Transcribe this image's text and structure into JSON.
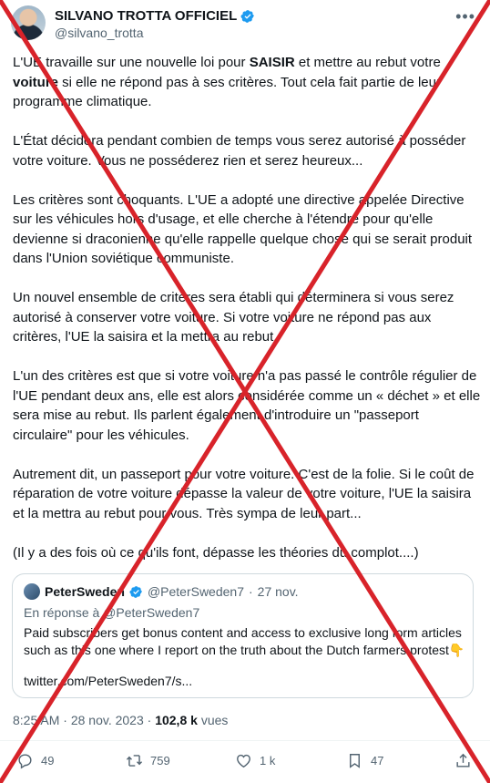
{
  "author": {
    "name": "SILVANO TROTTA OFFICIEL",
    "handle": "@silvano_trotta"
  },
  "tweet": {
    "paragraphs": [
      {
        "parts": [
          {
            "text": "L'UE travaille sur une nouvelle loi pour ",
            "bold": false
          },
          {
            "text": "SAISIR",
            "bold": true
          },
          {
            "text": " et mettre au rebut votre ",
            "bold": false
          },
          {
            "text": "voiture",
            "bold": true
          },
          {
            "text": " si elle ne répond pas à ses critères.  Tout cela fait partie de leur programme climatique.",
            "bold": false
          }
        ]
      },
      {
        "parts": [
          {
            "text": "L'État décidera pendant combien de temps vous serez autorisé à posséder votre voiture.  Vous ne posséderez rien et serez heureux...",
            "bold": false
          }
        ]
      },
      {
        "parts": [
          {
            "text": "Les critères sont choquants.  L'UE a adopté une directive appelée Directive sur les véhicules hors d'usage, et elle cherche à l'étendre pour qu'elle devienne si draconienne qu'elle rappelle quelque chose qui se serait produit dans l'Union soviétique communiste.",
            "bold": false
          }
        ]
      },
      {
        "parts": [
          {
            "text": "Un nouvel ensemble de critères sera établi qui déterminera si vous serez autorisé à conserver votre voiture. Si votre voiture ne répond pas aux critères, l'UE la saisira et la mettra au rebut.",
            "bold": false
          }
        ]
      },
      {
        "parts": [
          {
            "text": "L'un des critères est que si votre voiture n'a pas passé le contrôle régulier de l'UE pendant deux ans, elle est alors considérée comme un « déchet » et elle sera mise au rebut.  Ils parlent également d'introduire un \"passeport circulaire\" pour les véhicules.",
            "bold": false
          }
        ]
      },
      {
        "parts": [
          {
            "text": "Autrement dit, un passeport pour votre voiture. C'est de la folie.  Si le coût de réparation de votre voiture dépasse la valeur de votre voiture, l'UE la saisira et la mettra au rebut pour vous. Très sympa de leur part...",
            "bold": false
          }
        ]
      },
      {
        "parts": [
          {
            "text": "(Il y a des fois où ce qu'ils font, dépasse les théories du complot....)",
            "bold": false
          }
        ]
      }
    ]
  },
  "quote": {
    "name": "PeterSweden",
    "handle": "@PeterSweden7",
    "separator": "·",
    "date": "27 nov.",
    "reply_to": "En réponse à @PeterSweden7",
    "body": "Paid subscribers get bonus content and access to exclusive long form articles such as this one where I report on the truth about the Dutch farmers protest",
    "emoji": "👇",
    "link": "twitter.com/PeterSweden7/s..."
  },
  "meta": {
    "time": "8:25 AM",
    "separator": "·",
    "date": "28 nov. 2023",
    "views_count": "102,8 k",
    "views_label": "vues"
  },
  "actions": {
    "replies": "49",
    "retweets": "759",
    "likes": "1 k",
    "bookmarks": "47"
  },
  "icons": {
    "verified": "verified-badge-icon",
    "more": "more-options-icon",
    "reply": "reply-icon",
    "retweet": "retweet-icon",
    "like": "heart-icon",
    "bookmark": "bookmark-icon",
    "share": "share-icon"
  },
  "colors": {
    "verified": "#1d9bf0",
    "cross": "#d8232a",
    "secondary_text": "#536471"
  }
}
